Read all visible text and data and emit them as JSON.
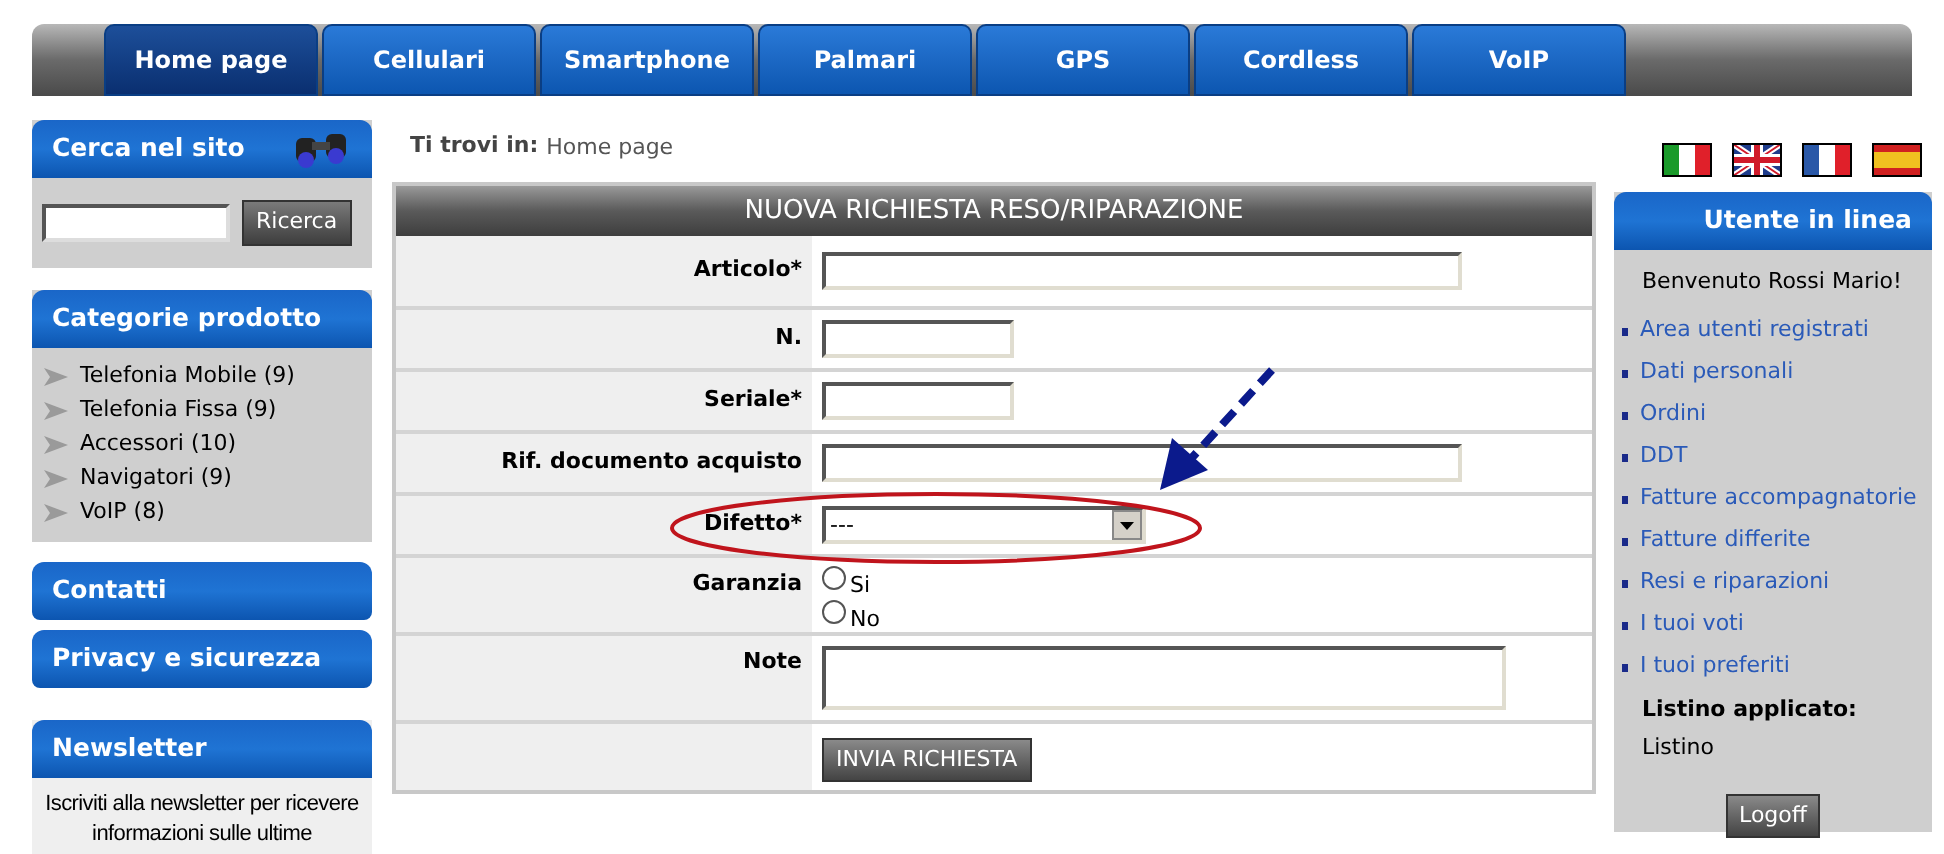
{
  "nav_tabs": [
    {
      "label": "Home page",
      "selected": true
    },
    {
      "label": "Cellulari",
      "selected": false
    },
    {
      "label": "Smartphone",
      "selected": false
    },
    {
      "label": "Palmari",
      "selected": false
    },
    {
      "label": "GPS",
      "selected": false
    },
    {
      "label": "Cordless",
      "selected": false
    },
    {
      "label": "VoIP",
      "selected": false
    }
  ],
  "search_box": {
    "title": "Cerca nel sito",
    "button": "Ricerca"
  },
  "categories": {
    "title": "Categorie prodotto",
    "items": [
      "Telefonia Mobile (9)",
      "Telefonia Fissa (9)",
      "Accessori (10)",
      "Navigatori (9)",
      "VoIP (8)"
    ]
  },
  "side_links": [
    "Contatti",
    "Privacy e sicurezza"
  ],
  "newsletter": {
    "title": "Newsletter",
    "text": "Iscriviti alla newsletter per ricevere informazioni sulle ultime"
  },
  "breadcrumb": {
    "label": "Ti trovi in:",
    "current": "Home page"
  },
  "form": {
    "title": "NUOVA RICHIESTA RESO/RIPARAZIONE",
    "fields": [
      {
        "kind": "wide_text",
        "label": "Articolo*"
      },
      {
        "kind": "narrow_text",
        "label": "N."
      },
      {
        "kind": "narrow_text",
        "label": "Seriale*"
      },
      {
        "kind": "wide_text",
        "label": "Rif. documento acquisto"
      },
      {
        "kind": "select",
        "label": "Difetto*",
        "value": "---"
      },
      {
        "kind": "radio",
        "label": "Garanzia",
        "options": [
          {
            "label": "Si",
            "selected": false
          },
          {
            "label": "No",
            "selected": false
          }
        ]
      },
      {
        "kind": "textarea",
        "label": "Note"
      }
    ],
    "submit": "INVIA RICHIESTA"
  },
  "user_panel": {
    "title": "Utente in linea",
    "welcome": "Benvenuto Rossi Mario!",
    "links": [
      "Area utenti registrati",
      "Dati personali",
      "Ordini",
      "DDT",
      "Fatture accompagnatorie",
      "Fatture differite",
      "Resi e riparazioni",
      "I tuoi voti",
      "I tuoi preferiti"
    ],
    "price_list_label": "Listino applicato:",
    "price_list": "Listino",
    "logoff": "Logoff"
  }
}
